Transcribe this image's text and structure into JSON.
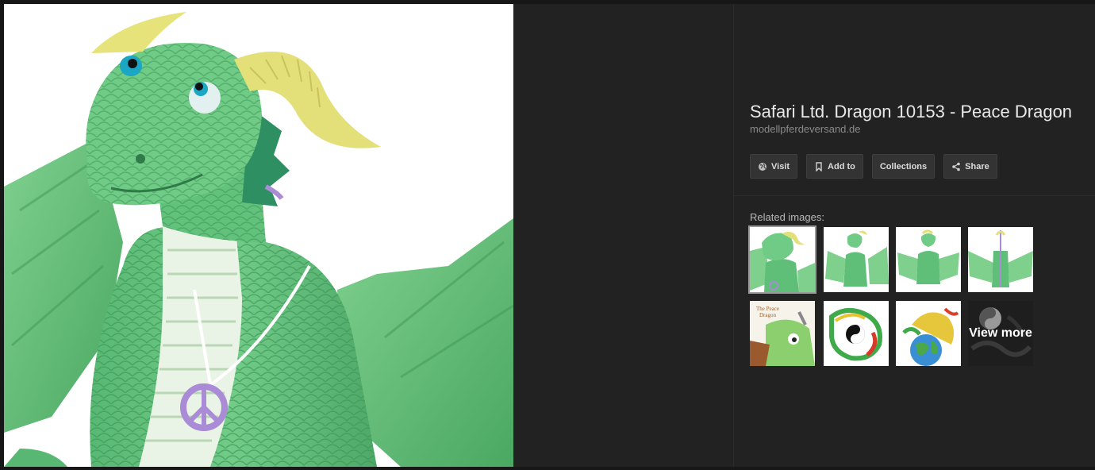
{
  "image": {
    "subject": "green peace dragon figurine"
  },
  "info": {
    "title": "Safari Ltd. Dragon 10153 - Peace Dragon",
    "domain": "modellpferdeversand.de"
  },
  "actions": [
    {
      "label": "Visit",
      "icon": "globe-icon"
    },
    {
      "label": "Add to",
      "icon": "bookmark-icon"
    },
    {
      "label": "Collections",
      "icon": ""
    },
    {
      "label": "Share",
      "icon": "share-icon"
    }
  ],
  "related": {
    "label": "Related images:",
    "view_more": "View more"
  },
  "colors": {
    "background": "#222222",
    "dragon_green": "#5fbf78",
    "horn_yellow": "#e3e07a",
    "peace_purple": "#a98bd6"
  }
}
